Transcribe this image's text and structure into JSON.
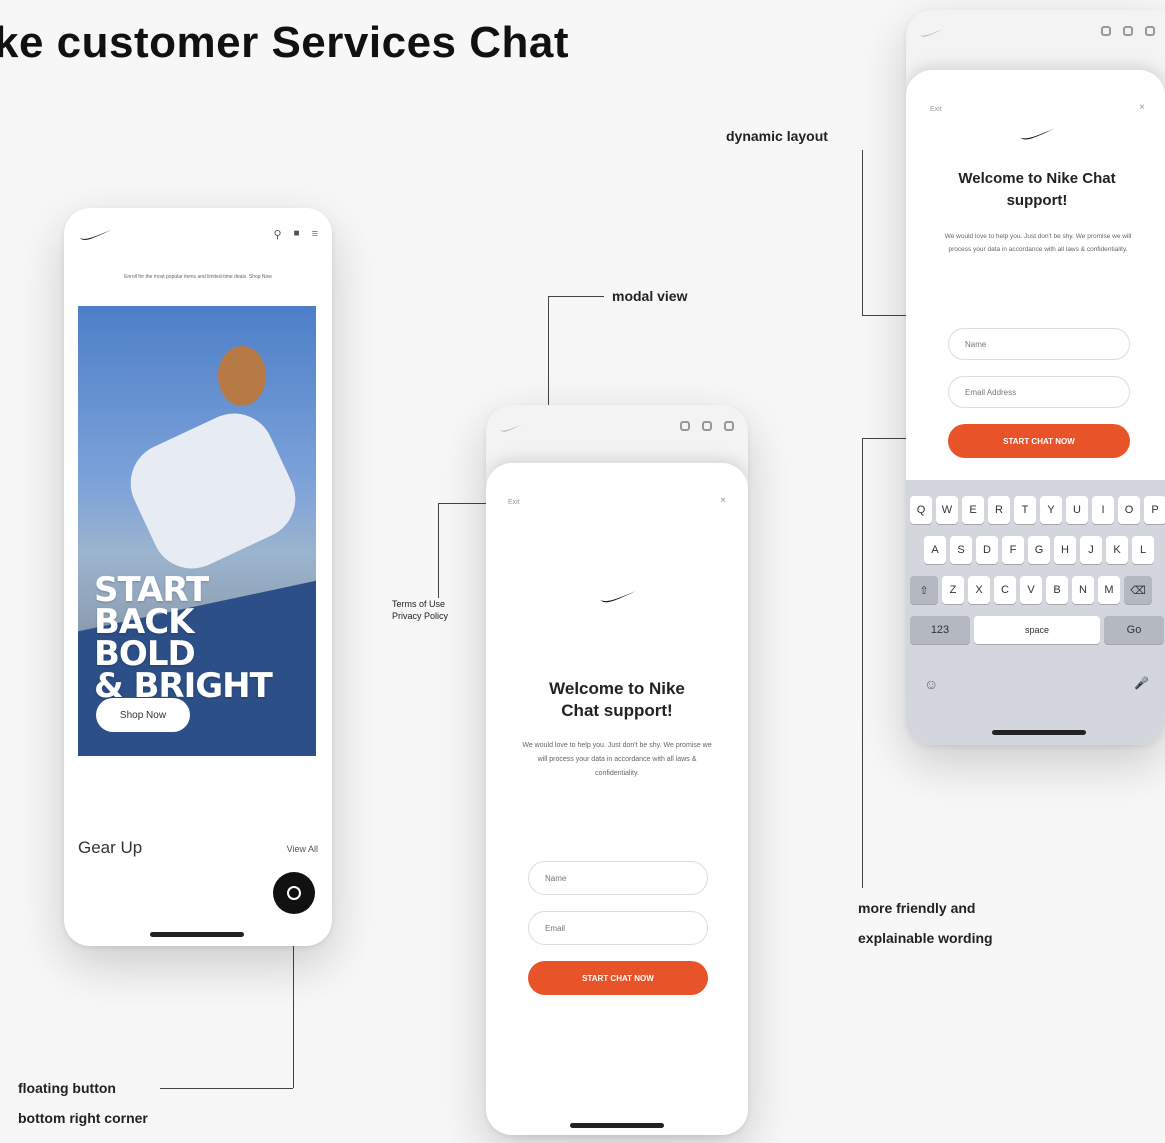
{
  "title": "ke customer Services Chat",
  "annotations": {
    "dynamic_layout": "dynamic layout",
    "modal_view": "modal view",
    "terms": "Terms of Use\nPrivacy Policy",
    "friendly_wording_1": "more friendly and",
    "friendly_wording_2": "explainable wording",
    "floating_button_1": "floating button",
    "floating_button_2": "bottom right corner"
  },
  "home_screen": {
    "promo_banner": "Enroll for the most popular items and limited-time deals. Shop Now",
    "hero_text_1": "START BACK",
    "hero_text_2": "BOLD",
    "hero_text_3": "& BRIGHT",
    "shop_button": "Shop Now",
    "section_title": "Gear Up",
    "view_all": "View All"
  },
  "chat_modal": {
    "back_label": "Exit",
    "close_label": "×",
    "welcome": "Welcome to Nike Chat support!",
    "description": "We would love to help you. Just don't be shy. We promise we will process your data in accordance with all laws & confidentiality.",
    "name_placeholder": "Name",
    "email_placeholder": "Email",
    "cta": "START CHAT NOW"
  },
  "dynamic_modal": {
    "back_label": "Exit",
    "close_label": "×",
    "welcome": "Welcome to Nike Chat support!",
    "description": "We would love to help you. Just don't be shy. We promise we will process your data in accordance with all laws & confidentiality.",
    "name_value": "Name",
    "email_value": "Email Address",
    "cta": "START CHAT NOW"
  },
  "keyboard": {
    "row1": [
      "Q",
      "W",
      "E",
      "R",
      "T",
      "Y",
      "U",
      "I",
      "O",
      "P"
    ],
    "row2": [
      "A",
      "S",
      "D",
      "F",
      "G",
      "H",
      "J",
      "K",
      "L"
    ],
    "row3": [
      "Z",
      "X",
      "C",
      "V",
      "B",
      "N",
      "M"
    ],
    "shift": "⇧",
    "delete": "⌫",
    "numbers": "123",
    "space": "space",
    "go": "Go",
    "emoji": "☺",
    "mic": "🎤"
  },
  "colors": {
    "accent": "#e8532a",
    "hero_blue": "#4d7fc9"
  }
}
